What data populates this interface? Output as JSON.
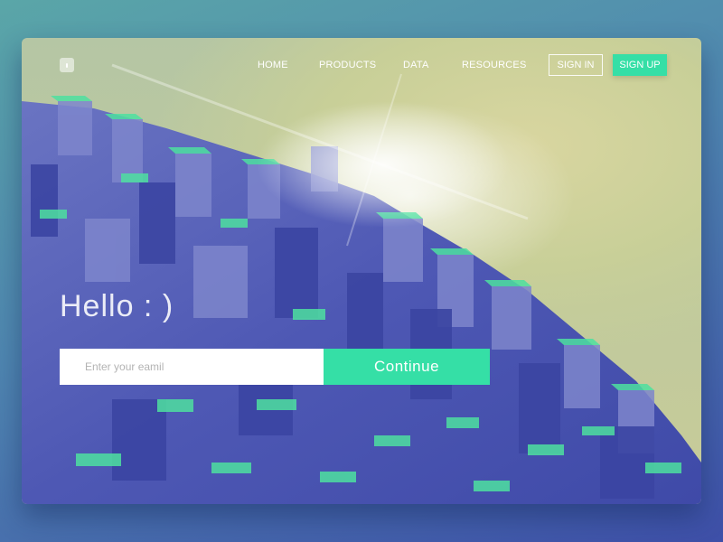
{
  "nav": {
    "items": [
      {
        "label": "HOME"
      },
      {
        "label": "PRODUCTS"
      },
      {
        "label": "DATA"
      },
      {
        "label": "RESOURCES"
      }
    ],
    "sign_in": "SIGN IN",
    "sign_up": "SIGN UP"
  },
  "hero": {
    "greeting": "Hello : )",
    "email_placeholder": "Enter your eamil",
    "email_value": "",
    "continue_label": "Continue"
  },
  "colors": {
    "accent": "#35dfa6",
    "cube_blue": "#4a57b3",
    "cube_green": "#4ee0a0",
    "sky": "#d9d6a0"
  }
}
